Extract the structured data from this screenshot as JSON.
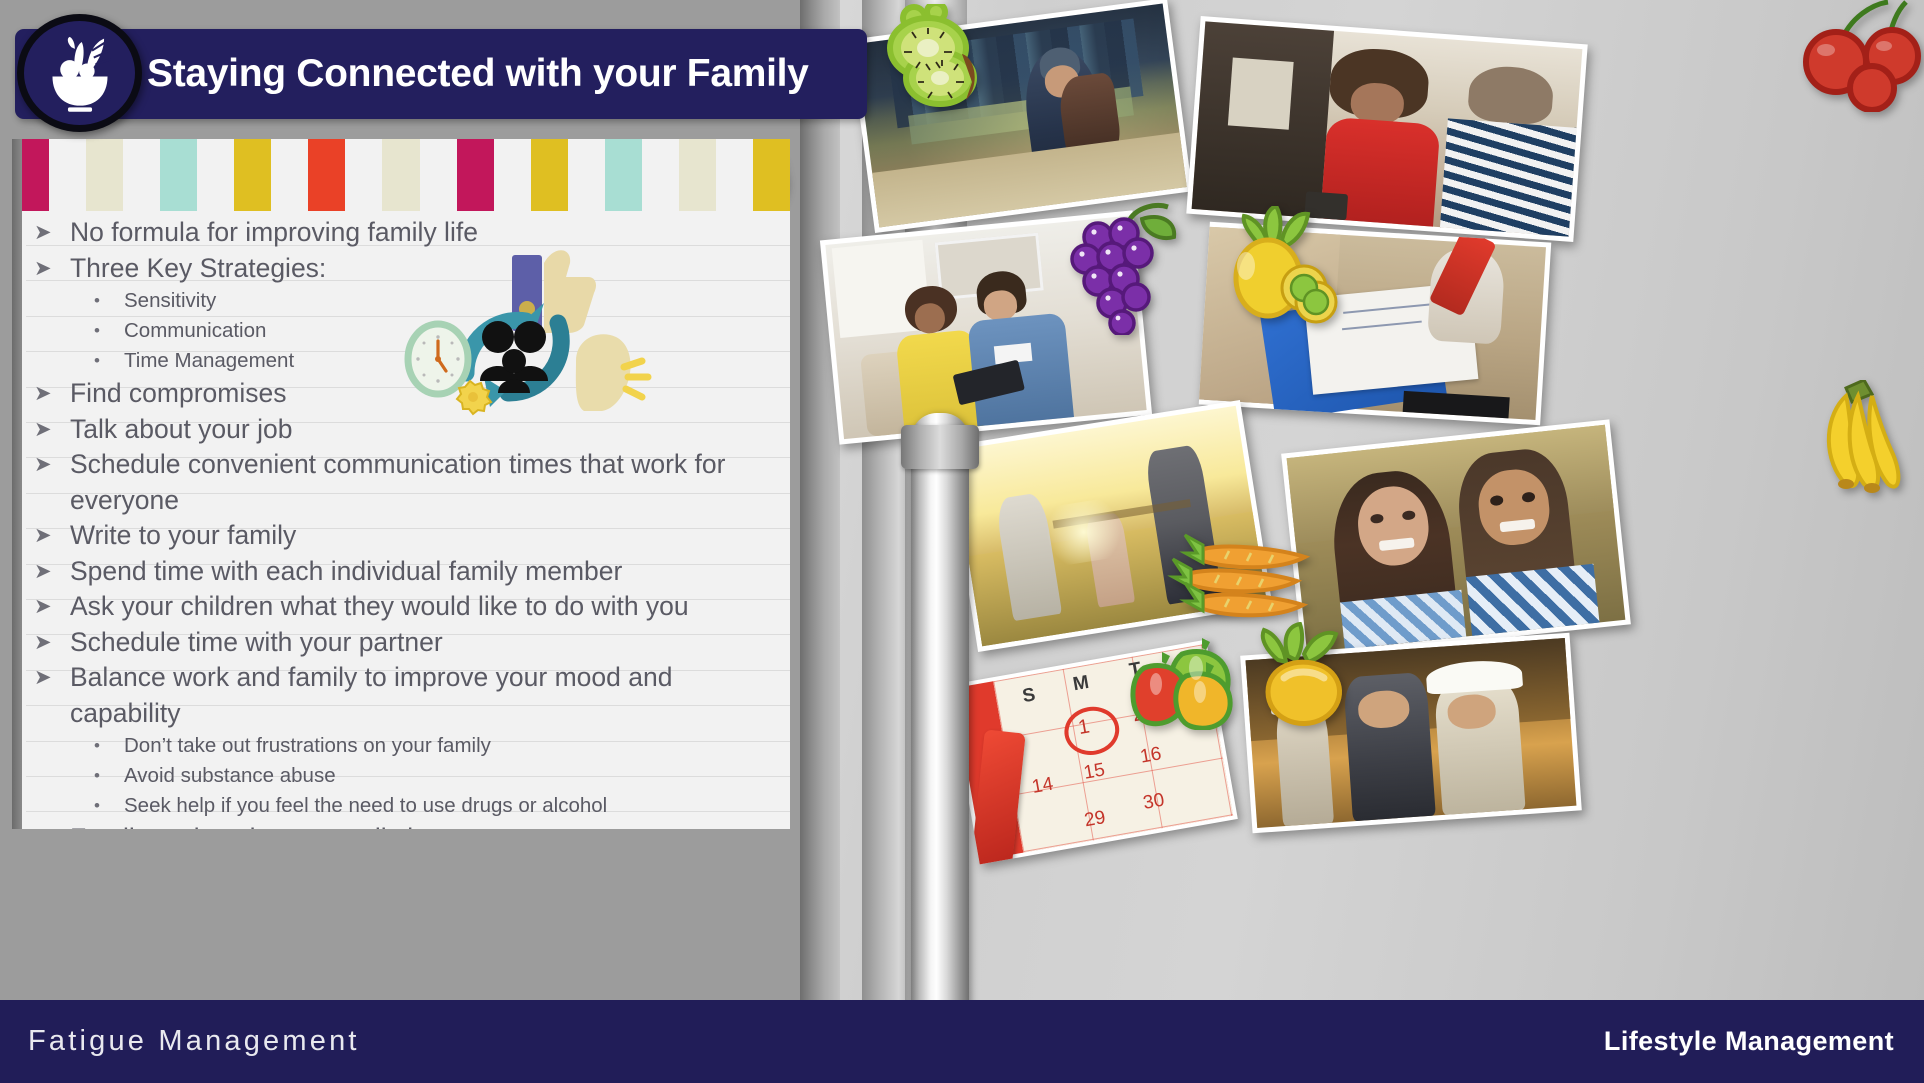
{
  "slide": {
    "title": "Staying Connected with your Family",
    "logo_icon": "fruit-bowl-icon"
  },
  "footer": {
    "left_label": "Fatigue Management",
    "right_label": "Lifestyle Management"
  },
  "colors": {
    "title_bar": "#231f5e",
    "footer_bar": "#211d58",
    "text": "#5a5a64",
    "stripe_magenta": "#c2175b",
    "stripe_cream": "#e7e5cf",
    "stripe_mint": "#a8ded3",
    "stripe_gold": "#dfbf22",
    "stripe_red": "#ea4127",
    "panel_bg": "#f2f2f2",
    "teal": "#3a96aa"
  },
  "stripe_sequence": [
    "#c2175b",
    "#f2f2f2",
    "#e7e5cf",
    "#f2f2f2",
    "#a8ded3",
    "#f2f2f2",
    "#dfbf22",
    "#f2f2f2",
    "#ea4127",
    "#f2f2f2",
    "#e7e5cf",
    "#f2f2f2",
    "#c2175b",
    "#f2f2f2",
    "#dfbf22",
    "#f2f2f2",
    "#a8ded3",
    "#f2f2f2",
    "#e7e5cf",
    "#f2f2f2",
    "#dfbf22"
  ],
  "bullets": [
    {
      "level": 1,
      "text": "No formula for improving family life"
    },
    {
      "level": 1,
      "text": "Three Key Strategies:"
    },
    {
      "level": 2,
      "text": "Sensitivity"
    },
    {
      "level": 2,
      "text": "Communication"
    },
    {
      "level": 2,
      "text": "Time Management"
    },
    {
      "level": 1,
      "text": "Find compromises"
    },
    {
      "level": 1,
      "text": "Talk about your job"
    },
    {
      "level": 1,
      "text": "Schedule convenient communication times that work for everyone"
    },
    {
      "level": 1,
      "text": "Write to your family"
    },
    {
      "level": 1,
      "text": "Spend time with each individual family member"
    },
    {
      "level": 1,
      "text": "Ask your children what they would like to do with you"
    },
    {
      "level": 1,
      "text": "Schedule time with your partner"
    },
    {
      "level": 1,
      "text": "Balance work and family to improve your mood and capability"
    },
    {
      "level": 2,
      "text": "Don’t take out frustrations on your family"
    },
    {
      "level": 2,
      "text": "Avoid substance abuse"
    },
    {
      "level": 2,
      "text": "Seek help if you feel the need to use drugs or alcohol"
    },
    {
      "level": 1,
      "text": "Family and work are equally important"
    }
  ],
  "clipart": {
    "items": [
      "thumbs-up-icon",
      "clock-icon",
      "gear-icon",
      "family-group-icon",
      "circular-arrows-icon",
      "speaking-head-icon"
    ]
  },
  "collage": {
    "photos": [
      {
        "name": "photo-woman-headphones-street",
        "caption": "Young woman with headphones smiling outdoors"
      },
      {
        "name": "photo-two-women-cafe-talking",
        "caption": "Two women laughing together in a cafe"
      },
      {
        "name": "photo-couple-sofa-tablet",
        "caption": "Couple on sofa looking at a tablet"
      },
      {
        "name": "photo-hand-writing-postcard",
        "caption": "Hand writing a postcard with red pen"
      },
      {
        "name": "photo-family-walking-field-sunset",
        "caption": "Family of three walking in a field at sunset"
      },
      {
        "name": "photo-mother-and-son-park",
        "caption": "Mother and son smiling in a park"
      },
      {
        "name": "photo-calendar-red-marker",
        "caption": "Calendar page circled with a red marker"
      },
      {
        "name": "photo-workers-hardhats",
        "caption": "Two workers in hard hats shaking hands"
      }
    ],
    "magnets": [
      {
        "name": "kiwi-magnet",
        "fruit": "kiwi"
      },
      {
        "name": "cherry-magnet",
        "fruit": "cherries"
      },
      {
        "name": "grapes-magnet",
        "fruit": "grapes"
      },
      {
        "name": "pineapple-magnet",
        "fruit": "pineapple"
      },
      {
        "name": "banana-magnet",
        "fruit": "bananas"
      },
      {
        "name": "carrot-magnet",
        "fruit": "carrots"
      },
      {
        "name": "bell-pepper-magnet",
        "fruit": "bell peppers"
      },
      {
        "name": "mango-magnet",
        "fruit": "mango"
      },
      {
        "name": "strawberry-magnet",
        "fruit": "strawberries"
      }
    ]
  }
}
